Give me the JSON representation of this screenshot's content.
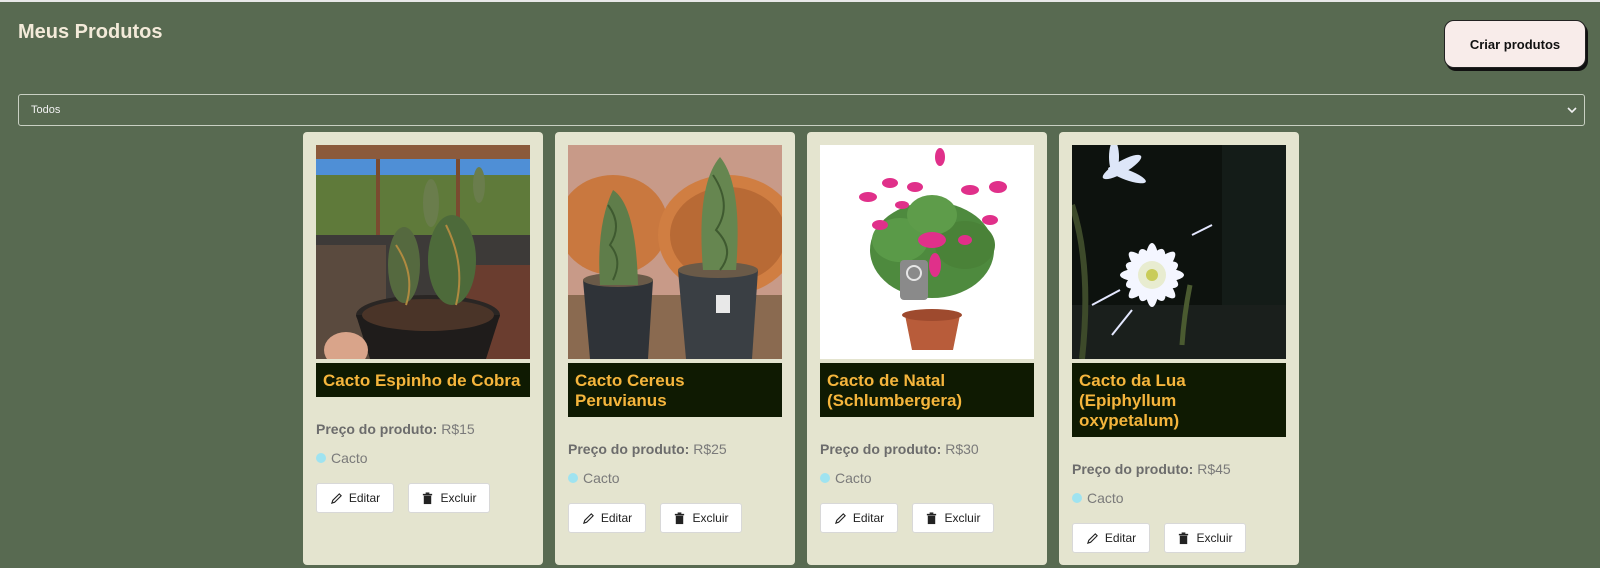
{
  "header": {
    "title": "Meus Produtos",
    "create_label": "Criar produtos"
  },
  "filter": {
    "selected": "Todos"
  },
  "products": [
    {
      "name": "Cacto Espinho de Cobra",
      "price_label": "Preço do produto:",
      "price": "R$15",
      "category": "Cacto",
      "edit_label": "Editar",
      "delete_label": "Excluir"
    },
    {
      "name": "Cacto Cereus Peruvianus",
      "price_label": "Preço do produto:",
      "price": "R$25",
      "category": "Cacto",
      "edit_label": "Editar",
      "delete_label": "Excluir"
    },
    {
      "name": "Cacto de Natal (Schlumbergera)",
      "price_label": "Preço do produto:",
      "price": "R$30",
      "category": "Cacto",
      "edit_label": "Editar",
      "delete_label": "Excluir"
    },
    {
      "name": "Cacto da Lua (Epiphyllum oxypetalum)",
      "price_label": "Preço do produto:",
      "price": "R$45",
      "category": "Cacto",
      "edit_label": "Editar",
      "delete_label": "Excluir"
    }
  ],
  "colors": {
    "background": "#586a51",
    "card": "#e4e4cf",
    "title_box": "#0f1a02",
    "title_text": "#f5b53c",
    "category_dot": "#9fe3f0"
  },
  "icons": {
    "edit": "pencil-icon",
    "delete": "trash-icon",
    "select": "chevron-down-icon"
  }
}
